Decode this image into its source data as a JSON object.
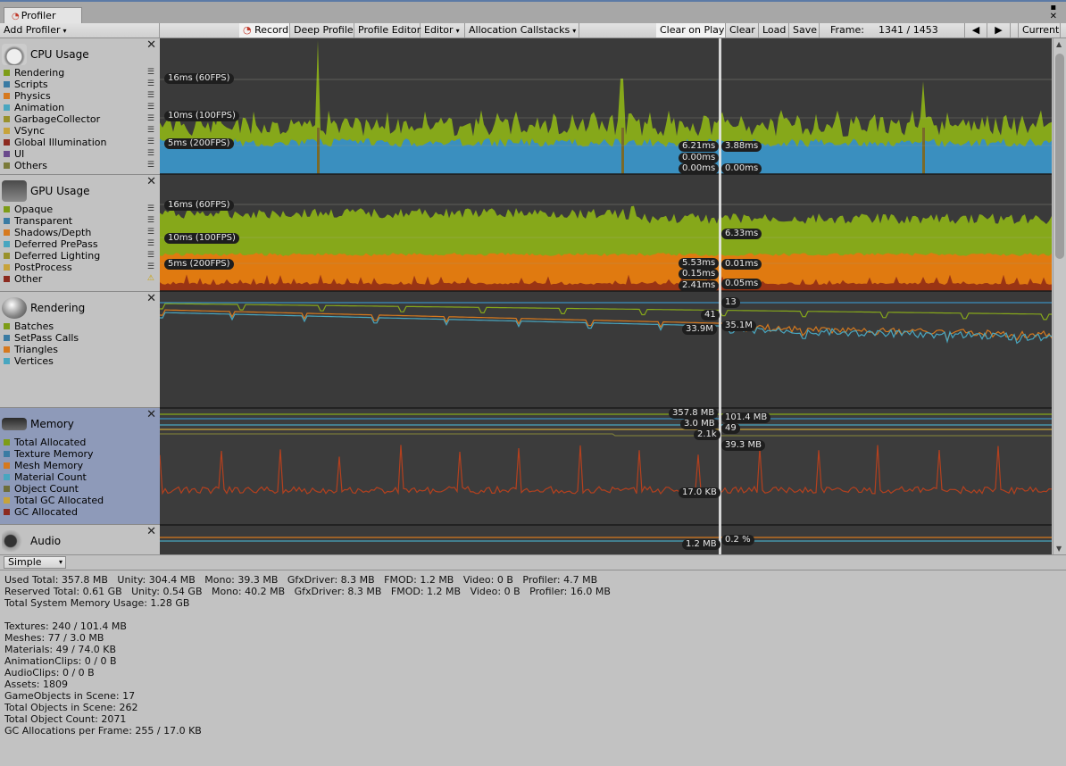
{
  "window": {
    "tab_title": "Profiler"
  },
  "toolbar": {
    "add_profiler": "Add Profiler",
    "record": "Record",
    "deep_profile": "Deep Profile",
    "profile_editor": "Profile Editor",
    "editor": "Editor",
    "allocation_callstacks": "Allocation Callstacks",
    "clear_on_play": "Clear on Play",
    "clear": "Clear",
    "load": "Load",
    "save": "Save",
    "frame_label": "Frame:",
    "frame_value": "1341 / 1453",
    "current": "Current"
  },
  "modules": {
    "cpu": {
      "title": "CPU Usage",
      "items": [
        {
          "label": "Rendering",
          "color": "#7d9c16"
        },
        {
          "label": "Scripts",
          "color": "#3a7ba3"
        },
        {
          "label": "Physics",
          "color": "#d6791e"
        },
        {
          "label": "Animation",
          "color": "#48a6c0"
        },
        {
          "label": "GarbageCollector",
          "color": "#99912b"
        },
        {
          "label": "VSync",
          "color": "#c7a33a"
        },
        {
          "label": "Global Illumination",
          "color": "#8c2a1f"
        },
        {
          "label": "UI",
          "color": "#6a4a8c"
        },
        {
          "label": "Others",
          "color": "#7a7a3a"
        }
      ]
    },
    "gpu": {
      "title": "GPU Usage",
      "items": [
        {
          "label": "Opaque",
          "color": "#7d9c16"
        },
        {
          "label": "Transparent",
          "color": "#3a7ba3"
        },
        {
          "label": "Shadows/Depth",
          "color": "#d6791e"
        },
        {
          "label": "Deferred PrePass",
          "color": "#48a6c0"
        },
        {
          "label": "Deferred Lighting",
          "color": "#99912b"
        },
        {
          "label": "PostProcess",
          "color": "#c7a33a"
        },
        {
          "label": "Other",
          "color": "#8c2a1f"
        }
      ]
    },
    "rendering": {
      "title": "Rendering",
      "items": [
        {
          "label": "Batches",
          "color": "#7d9c16"
        },
        {
          "label": "SetPass Calls",
          "color": "#3a7ba3"
        },
        {
          "label": "Triangles",
          "color": "#d6791e"
        },
        {
          "label": "Vertices",
          "color": "#48a6c0"
        }
      ]
    },
    "memory": {
      "title": "Memory",
      "items": [
        {
          "label": "Total Allocated",
          "color": "#7d9c16"
        },
        {
          "label": "Texture Memory",
          "color": "#3a7ba3"
        },
        {
          "label": "Mesh Memory",
          "color": "#d6791e"
        },
        {
          "label": "Material Count",
          "color": "#48a6c0"
        },
        {
          "label": "Object Count",
          "color": "#6d6d3a"
        },
        {
          "label": "Total GC Allocated",
          "color": "#c7a33a"
        },
        {
          "label": "GC Allocated",
          "color": "#8c2a1f"
        }
      ]
    },
    "audio": {
      "title": "Audio"
    }
  },
  "graph_labels": {
    "cpu": {
      "fps60": "16ms (60FPS)",
      "fps100": "10ms (100FPS)",
      "fps200": "5ms (200FPS)",
      "a": "6.21ms",
      "b": "3.88ms",
      "c": "0.00ms",
      "d": "0.00ms",
      "e": "0.00ms"
    },
    "gpu": {
      "fps60": "16ms (60FPS)",
      "fps100": "10ms (100FPS)",
      "fps200": "5ms (200FPS)",
      "a": "6.33ms",
      "b": "5.53ms",
      "c": "0.01ms",
      "d": "0.15ms",
      "e": "2.41ms",
      "f": "0.05ms"
    },
    "rendering": {
      "a": "13",
      "b": "41",
      "c": "33.9M",
      "d": "35.1M"
    },
    "memory": {
      "a": "357.8 MB",
      "b": "101.4 MB",
      "c": "3.0 MB",
      "d": "49",
      "e": "2.1k",
      "f": "39.3 MB",
      "g": "17.0 KB"
    },
    "audio": {
      "a": "1.2 MB",
      "b": "0.2 %"
    }
  },
  "bottom": {
    "view_mode": "Simple"
  },
  "details": [
    "Used Total: 357.8 MB   Unity: 304.4 MB   Mono: 39.3 MB   GfxDriver: 8.3 MB   FMOD: 1.2 MB   Video: 0 B   Profiler: 4.7 MB",
    "Reserved Total: 0.61 GB   Unity: 0.54 GB   Mono: 40.2 MB   GfxDriver: 8.3 MB   FMOD: 1.2 MB   Video: 0 B   Profiler: 16.0 MB",
    "Total System Memory Usage: 1.28 GB",
    "",
    "Textures: 240 / 101.4 MB",
    "Meshes: 77 / 3.0 MB",
    "Materials: 49 / 74.0 KB",
    "AnimationClips: 0 / 0 B",
    "AudioClips: 0 / 0 B",
    "Assets: 1809",
    "GameObjects in Scene: 17",
    "Total Objects in Scene: 262",
    "Total Object Count: 2071",
    "GC Allocations per Frame: 255 / 17.0 KB"
  ]
}
